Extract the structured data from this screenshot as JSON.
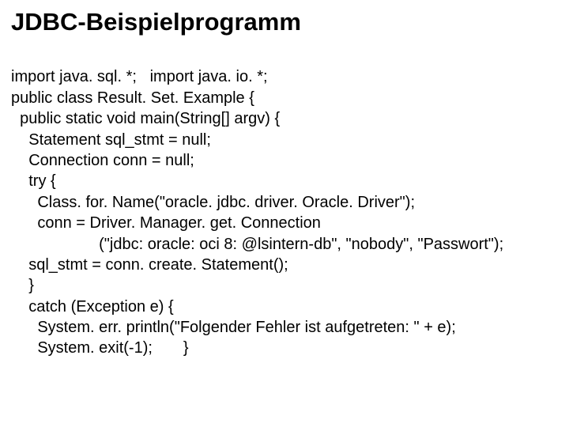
{
  "title": "JDBC-Beispielprogramm",
  "code": {
    "l01": "import java. sql. *;   import java. io. *;",
    "l02": "public class Result. Set. Example {",
    "l03": "  public static void main(String[] argv) {",
    "l04": "    Statement sql_stmt = null;",
    "l05": "    Connection conn = null;",
    "l06": "    try {",
    "l07": "      Class. for. Name(\"oracle. jdbc. driver. Oracle. Driver\");",
    "l08": "      conn = Driver. Manager. get. Connection",
    "l09": "                    (\"jdbc: oracle: oci 8: @lsintern-db\", \"nobody\", \"Passwort\");",
    "l10": "    sql_stmt = conn. create. Statement();",
    "l11": "    }",
    "l12": "    catch (Exception e) {",
    "l13": "      System. err. println(\"Folgender Fehler ist aufgetreten: \" + e);",
    "l14": "      System. exit(-1);       }"
  }
}
